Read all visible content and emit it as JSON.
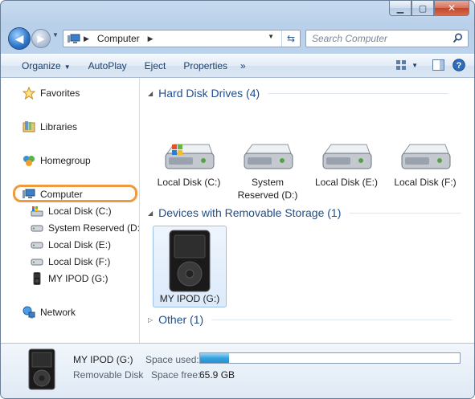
{
  "nav": {
    "address_crumb": "Computer",
    "search_placeholder": "Search Computer"
  },
  "toolbar": {
    "organize": "Organize",
    "autoplay": "AutoPlay",
    "eject": "Eject",
    "properties": "Properties",
    "more": "»"
  },
  "sidebar": {
    "favorites": "Favorites",
    "libraries": "Libraries",
    "homegroup": "Homegroup",
    "computer": "Computer",
    "drives": [
      "Local Disk (C:)",
      "System Reserved (D:)",
      "Local Disk (E:)",
      "Local Disk (F:)",
      "MY IPOD (G:)"
    ],
    "network": "Network"
  },
  "content": {
    "group_hdd": "Hard Disk Drives (4)",
    "group_removable": "Devices with Removable Storage (1)",
    "group_other": "Other (1)",
    "drives": [
      {
        "line1": "Local Disk (C:)",
        "line2": ""
      },
      {
        "line1": "System",
        "line2": "Reserved (D:)"
      },
      {
        "line1": "Local Disk (E:)",
        "line2": ""
      },
      {
        "line1": "Local Disk (F:)",
        "line2": ""
      }
    ],
    "ipod_label": "MY IPOD (G:)"
  },
  "details": {
    "name": "MY IPOD (G:)",
    "type": "Removable Disk",
    "space_used_label": "Space used:",
    "space_free_label": "Space free:",
    "space_free_value": "65.9 GB",
    "space_used_fraction": 0.11
  }
}
